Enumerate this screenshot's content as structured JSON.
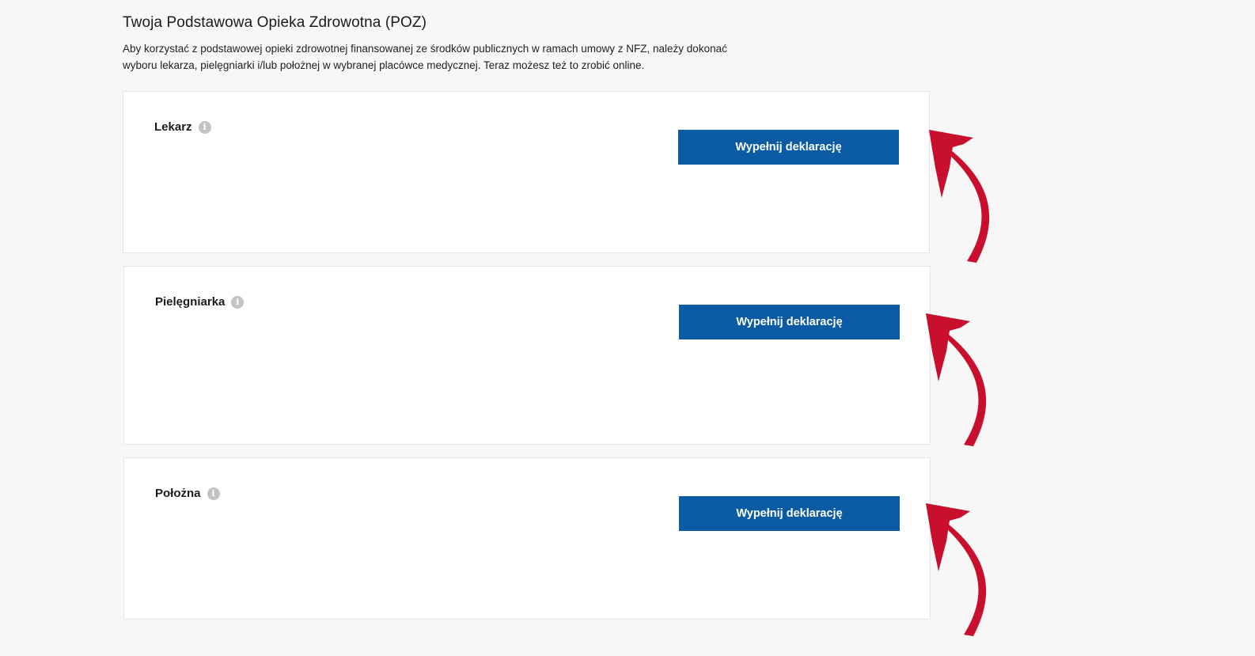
{
  "page": {
    "title": "Twoja Podstawowa Opieka Zdrowotna (POZ)",
    "description": "Aby korzystać z podstawowej opieki zdrowotnej finansowanej ze środków publicznych w ramach umowy z NFZ, należy dokonać wyboru lekarza, pielęgniarki i/lub położnej w wybranej placówce medycznej. Teraz możesz też to zrobić online."
  },
  "cards": [
    {
      "label": "Lekarz",
      "button_label": "Wypełnij deklarację"
    },
    {
      "label": "Pielęgniarka",
      "button_label": "Wypełnij deklarację"
    },
    {
      "label": "Położna",
      "button_label": "Wypełnij deklarację"
    }
  ],
  "icons": {
    "info": "info-icon",
    "annotation": "curved-arrow-icon"
  },
  "colors": {
    "primary_button": "#0a5ba3",
    "annotation_arrow": "#c8102e",
    "info_icon": "#c3c3c3"
  }
}
